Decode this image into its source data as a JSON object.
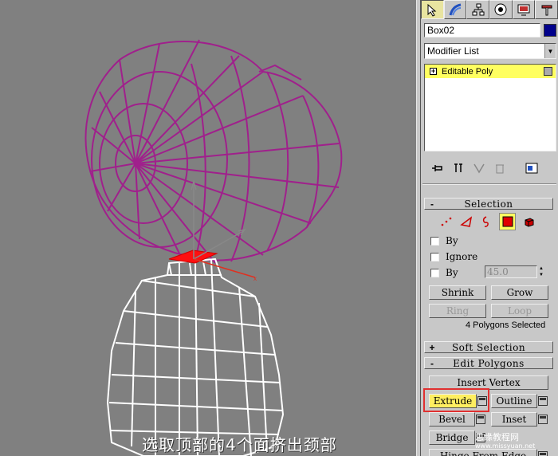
{
  "viewport": {
    "caption": "选取顶部的4个面挤出颈部"
  },
  "command_panel": {
    "tabs": [
      "create",
      "modify",
      "hierarchy",
      "motion",
      "display",
      "utilities"
    ],
    "object_name": "Box02",
    "object_color": "#00008b",
    "modifier_list": "Modifier List",
    "stack": [
      {
        "label": "Editable Poly"
      }
    ]
  },
  "selection": {
    "title": "Selection",
    "sign": "-",
    "checkboxes": {
      "by": "By",
      "ignore": "Ignore",
      "by_angle": "By",
      "angle_value": "45.0"
    },
    "buttons": {
      "shrink": "Shrink",
      "grow": "Grow",
      "ring": "Ring",
      "loop": "Loop"
    },
    "status": "4 Polygons Selected"
  },
  "soft_selection": {
    "title": "Soft Selection",
    "sign": "+"
  },
  "edit_polygons": {
    "title": "Edit Polygons",
    "sign": "-",
    "insert_vertex": "Insert Vertex",
    "extrude": "Extrude",
    "outline": "Outline",
    "bevel": "Bevel",
    "inset": "Inset",
    "bridge": "Bridge",
    "hinge": "Hinge From Edge"
  },
  "watermark": {
    "text": "思缘教程网",
    "url": "www.missyuan.net"
  }
}
